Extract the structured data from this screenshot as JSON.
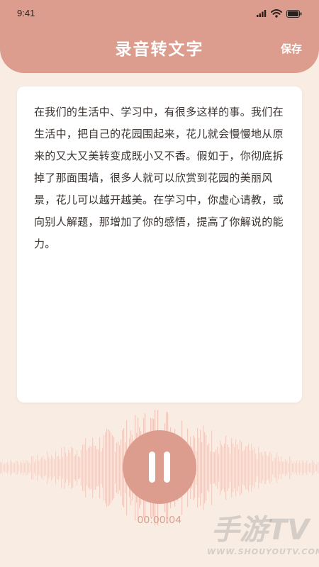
{
  "status_bar": {
    "time": "9:41"
  },
  "header": {
    "title": "录音转文字",
    "save_label": "保存"
  },
  "transcript": {
    "text": "在我们的生活中、学习中，有很多这样的事。我们在生活中，把自己的花园围起来，花儿就会慢慢地从原来的又大又美转变成既小又不香。假如于，你彻底拆掉了那面围墙，很多人就可以欣赏到花园的美丽风景，花儿可以越开越美。在学习中，你虚心请教，或向别人解题，那增加了你的感悟，提高了你解说的能力。"
  },
  "recorder": {
    "state_icon": "pause-icon",
    "elapsed": "00:00:04"
  },
  "watermark": {
    "main": "手游TV",
    "sub": "WWW.SHOUYOUTV.COM"
  },
  "colors": {
    "accent": "#dc9d8f",
    "background": "#f8ece3",
    "card": "#ffffff",
    "waveform": "#ebb8ac"
  }
}
